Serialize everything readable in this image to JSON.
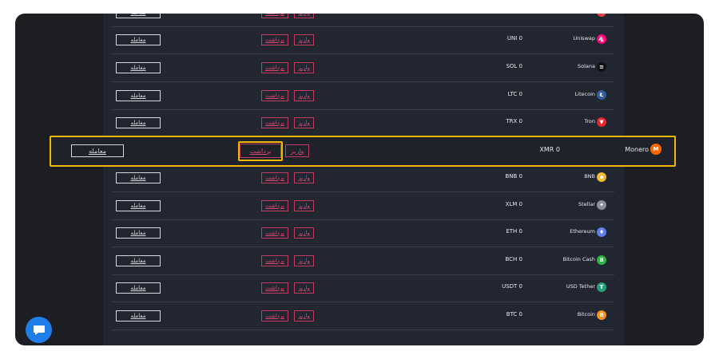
{
  "labels": {
    "trade": "معامله",
    "withdraw": "برداشت",
    "deposit": "واریز"
  },
  "partial_top_row": {
    "name": "",
    "amount": ""
  },
  "rows": [
    {
      "name": "Uniswap",
      "amount": "UNI 0",
      "icon": "uniswap-icon",
      "color": "#ff007a",
      "glyph": "🦄"
    },
    {
      "name": "Solana",
      "amount": "SOL 0",
      "icon": "solana-icon",
      "color": "#111111",
      "glyph": "≡"
    },
    {
      "name": "Litecoin",
      "amount": "LTC 0",
      "icon": "litecoin-icon",
      "color": "#345d9d",
      "glyph": "Ł"
    },
    {
      "name": "Tron",
      "amount": "TRX 0",
      "icon": "tron-icon",
      "color": "#e5242b",
      "glyph": "▼"
    },
    {
      "name": "BNB",
      "amount": "BNB 0",
      "icon": "bnb-icon",
      "color": "#f3ba2f",
      "glyph": "◆"
    },
    {
      "name": "Stellar",
      "amount": "XLM 0",
      "icon": "stellar-icon",
      "color": "#8a8f99",
      "glyph": "✦"
    },
    {
      "name": "Ethereum",
      "amount": "ETH 0",
      "icon": "ethereum-icon",
      "color": "#627eea",
      "glyph": "♦"
    },
    {
      "name": "Bitcoin Cash",
      "amount": "BCH 0",
      "icon": "bitcoin-cash-icon",
      "color": "#2fb344",
      "glyph": "B"
    },
    {
      "name": "USD Tether",
      "amount": "USDT 0",
      "icon": "tether-icon",
      "color": "#26a17b",
      "glyph": "T"
    },
    {
      "name": "Bitcoin",
      "amount": "BTC 0",
      "icon": "bitcoin-icon",
      "color": "#f7931a",
      "glyph": "B"
    }
  ],
  "highlight": {
    "name": "Monero",
    "amount": "XMR 0",
    "icon": "monero-icon",
    "color": "#ff6600",
    "glyph": "M"
  },
  "chat": {
    "icon": "chat-icon",
    "color": "#1f7ee8"
  }
}
